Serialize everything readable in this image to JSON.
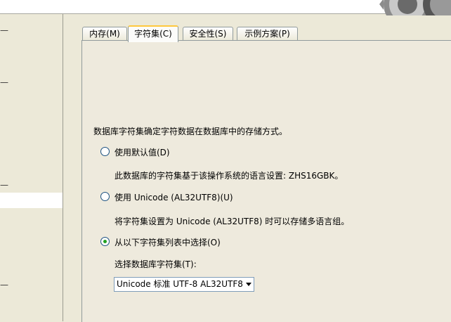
{
  "tabs": [
    {
      "label": "内存(M)"
    },
    {
      "label": "字符集(C)"
    },
    {
      "label": "安全性(S)"
    },
    {
      "label": "示例方案(P)"
    }
  ],
  "content": {
    "intro": "数据库字符集确定字符数据在数据库中的存储方式。",
    "options": [
      {
        "label": "使用默认值(D)",
        "description": "此数据库的字符集基于该操作系统的语言设置: ZHS16GBK。",
        "selected": false
      },
      {
        "label": "使用 Unicode (AL32UTF8)(U)",
        "description": "将字符集设置为 Unicode (AL32UTF8) 时可以存储多语言组。",
        "selected": false
      },
      {
        "label": "从以下字符集列表中选择(O)",
        "selected": true
      }
    ],
    "select_label": "选择数据库字符集(T):",
    "select_value": "Unicode 标准 UTF-8 AL32UTF8"
  },
  "colors": {
    "active_tab_accent": "#ffc83c",
    "radio_dot": "#21a121"
  }
}
